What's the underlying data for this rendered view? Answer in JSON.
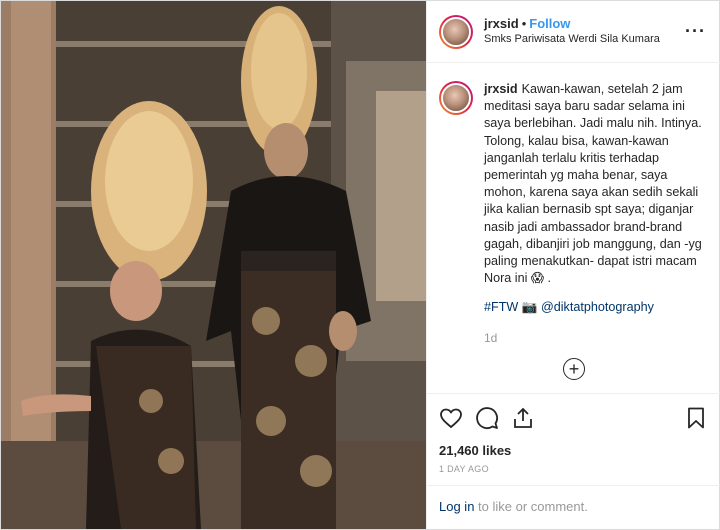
{
  "post": {
    "username": "jrxsid",
    "dot": "•",
    "follow": "Follow",
    "location": "Smks Pariwisata Werdi Sila Kumara",
    "more": "···"
  },
  "caption": {
    "username": "jrxsid",
    "text": "Kawan-kawan, setelah 2 jam meditasi saya baru sadar selama ini saya berlebihan. Jadi malu nih. Intinya. Tolong, kalau bisa, kawan-kawan janganlah terlalu kritis terhadap pemerintah yg maha benar, saya mohon, karena saya akan sedih sekali jika kalian bernasib spt saya; diganjar nasib jadi ambassador brand-brand gagah, dibanjiri job manggung, dan -yg paling menakutkan- dapat istri macam Nora ini 😱 .",
    "hashtag": "#FTW",
    "camera": "📷",
    "mention": "@diktatphotography",
    "time": "1d"
  },
  "load_more": "+",
  "actions": {
    "icons": [
      "heart-icon",
      "comment-icon",
      "share-icon",
      "bookmark-icon"
    ],
    "likes": "21,460 likes",
    "date": "1 DAY AGO"
  },
  "login": {
    "link": "Log in",
    "text": " to like or comment."
  },
  "colors": {
    "link_blue": "#3897f0",
    "hashtag": "#003569",
    "muted": "#999999"
  }
}
